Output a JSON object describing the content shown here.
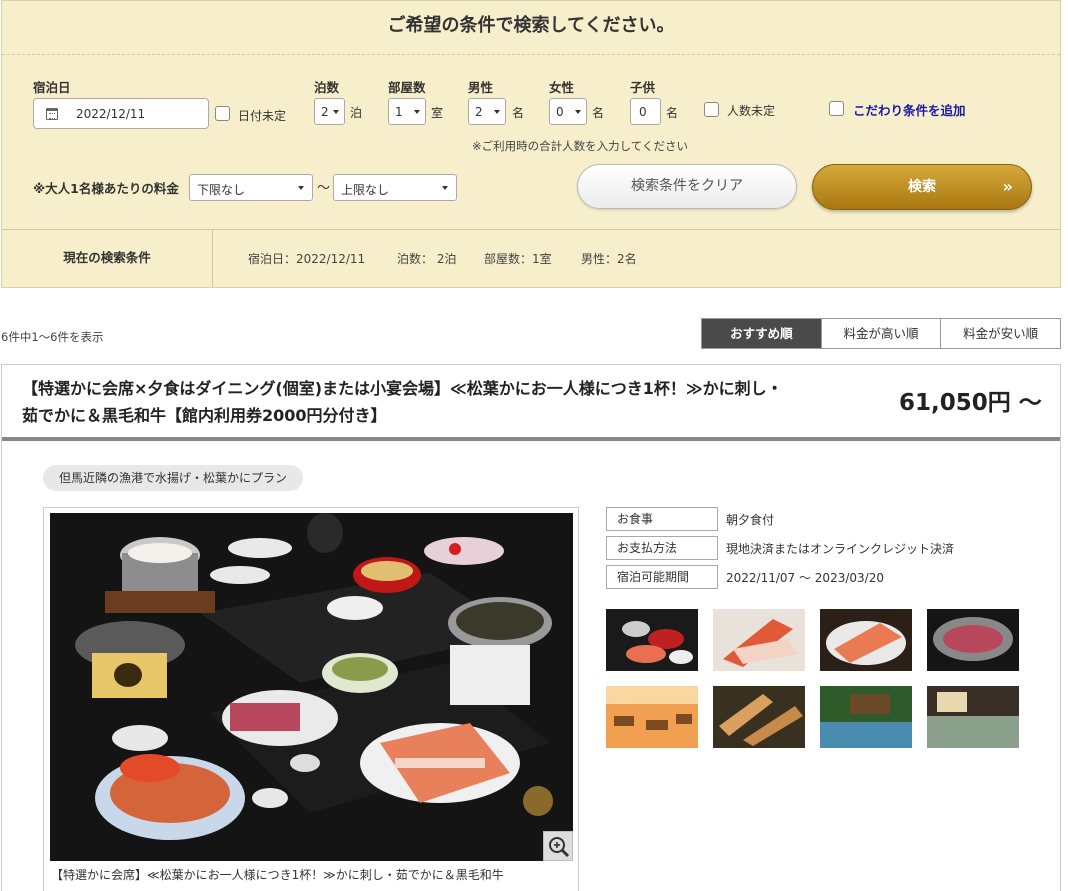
{
  "search": {
    "title": "ご希望の条件で検索してください。",
    "checkin_label": "宿泊日",
    "checkin_value": "2022/12/11",
    "date_undecided_label": "日付未定",
    "nights_label": "泊数",
    "nights_value": "2",
    "nights_unit": "泊",
    "rooms_label": "部屋数",
    "rooms_value": "1",
    "rooms_unit": "室",
    "male_label": "男性",
    "male_value": "2",
    "male_unit": "名",
    "female_label": "女性",
    "female_value": "0",
    "female_unit": "名",
    "child_label": "子供",
    "child_value": "0",
    "child_unit": "名",
    "people_undecided_label": "人数未定",
    "add_condition_label": "こだわり条件を追加",
    "people_note": "※ご利用時の合計人数を入力してください",
    "price_label": "※大人1名様あたりの料金",
    "price_min": "下限なし",
    "price_tilde": "〜",
    "price_max": "上限なし",
    "clear_label": "検索条件をクリア",
    "search_label": "検索",
    "search_chevron": "»",
    "current_label": "現在の検索条件",
    "current_items": [
      "宿泊日：2022/12/11",
      "泊数： 2泊",
      "部屋数：1室",
      "男性：2名"
    ]
  },
  "results": {
    "count_text": "6件中1〜6件を表示",
    "sort_tabs": [
      "おすすめ順",
      "料金が高い順",
      "料金が安い順"
    ]
  },
  "plan": {
    "title_line1": "【特選かに会席×夕食はダイニング(個室)または小宴会場】≪松葉かにお一人様につき1杯！≫かに刺し・",
    "title_line2": "茹でかに＆黒毛和牛【館内利用券2000円分付き】",
    "price": "61,050円 〜",
    "tag": "但馬近隣の漁港で水揚げ・松葉かにプラン",
    "photo_caption": "【特選かに会席】≪松葉かにお一人様につき1杯！≫かに刺し・茹でかに＆黒毛和牛",
    "info": [
      {
        "key": "お食事",
        "value": "朝夕食付"
      },
      {
        "key": "お支払方法",
        "value": "現地決済またはオンラインクレジット決済"
      },
      {
        "key": "宿泊可能期間",
        "value": "2022/11/07 〜 2023/03/20"
      }
    ]
  },
  "colors": {
    "panel_bg": "#f7efcb",
    "search_button": "#c4951f",
    "active_tab": "#4a4a4a",
    "link": "#1a1aa8"
  },
  "icons": [
    "calendar-icon",
    "dropdown-arrow-icon",
    "chevron-right-icon",
    "zoom-in-icon"
  ]
}
